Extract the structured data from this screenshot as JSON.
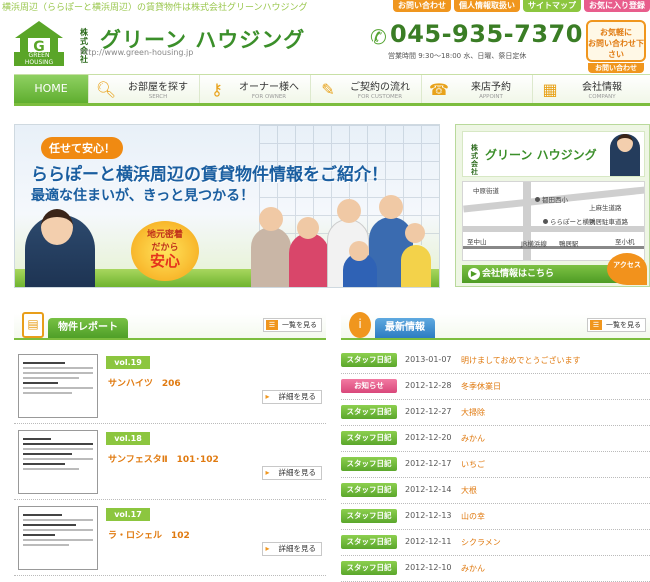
{
  "top": {
    "tagline": "横浜周辺（ららぽーと横浜周辺）の賃貸物件は株式会社グリーンハウジング",
    "links": [
      "お問い合わせ",
      "個人情報取扱い",
      "サイトマップ",
      "お気に入り登録"
    ]
  },
  "header": {
    "logo_text": "GREEN HOUSING",
    "kabu": "株式会社",
    "brand": "グリーン ハウジング",
    "url": "http://www.green-housing.jp",
    "phone": "045-935-7370",
    "hours": "営業時間 9:30〜18:00 水、日曜、祭日定休",
    "contact_line1": "お気軽に",
    "contact_line2": "お問い合わせ下さい",
    "contact_sub": "お問い合わせ"
  },
  "nav": {
    "home": "HOME",
    "items": [
      {
        "label": "お部屋を探す",
        "sub": "SERCH"
      },
      {
        "label": "オーナー様へ",
        "sub": "FOR OWNER"
      },
      {
        "label": "ご契約の流れ",
        "sub": "FOR CUSTOMER"
      },
      {
        "label": "来店予約",
        "sub": "APPOINT"
      },
      {
        "label": "会社情報",
        "sub": "COMPANY"
      }
    ]
  },
  "hero": {
    "badge": "任せて安心！",
    "title": "ららぽーと横浜周辺の賃貸物件情報をご紹介！",
    "subtitle": "最適な住まいが、きっと見つかる！",
    "local_line1": "地元密着",
    "local_line2": "だから",
    "local_big": "安心"
  },
  "side": {
    "kabu": "株式会社",
    "brand": "グリーン ハウジング",
    "map_labels": [
      "中原街道",
      "都田西小",
      "上麻生道路",
      "ららぽーと横浜",
      "鴨居駐車道路",
      "至中山",
      "JR横浜線",
      "鴨居駅",
      "至小机"
    ],
    "button": "会社情報はこちら",
    "access": "アクセス"
  },
  "reports": {
    "title": "物件レポート",
    "more": "一覧を見る",
    "detail": "詳細を見る",
    "items": [
      {
        "vol": "vol.19",
        "name": "サンハイツ　206"
      },
      {
        "vol": "vol.18",
        "name": "サンフェスタⅡ　101･102"
      },
      {
        "vol": "vol.17",
        "name": "ラ・ロシェル　102"
      }
    ]
  },
  "news": {
    "title": "最新情報",
    "more": "一覧を見る",
    "items": [
      {
        "cat": "スタッフ日記",
        "type": "staff",
        "date": "2013-01-07",
        "title": "明けましておめでとうございます"
      },
      {
        "cat": "お知らせ",
        "type": "notice",
        "date": "2012-12-28",
        "title": "冬季休業日"
      },
      {
        "cat": "スタッフ日記",
        "type": "staff",
        "date": "2012-12-27",
        "title": "大掃除"
      },
      {
        "cat": "スタッフ日記",
        "type": "staff",
        "date": "2012-12-20",
        "title": "みかん"
      },
      {
        "cat": "スタッフ日記",
        "type": "staff",
        "date": "2012-12-17",
        "title": "いちご"
      },
      {
        "cat": "スタッフ日記",
        "type": "staff",
        "date": "2012-12-14",
        "title": "大根"
      },
      {
        "cat": "スタッフ日記",
        "type": "staff",
        "date": "2012-12-13",
        "title": "山の幸"
      },
      {
        "cat": "スタッフ日記",
        "type": "staff",
        "date": "2012-12-11",
        "title": "シクラメン"
      },
      {
        "cat": "スタッフ日記",
        "type": "staff",
        "date": "2012-12-10",
        "title": "みかん"
      }
    ]
  },
  "colors": {
    "brand_green": "#5aa528",
    "accent_orange": "#f0961e",
    "notice_pink": "#e85d8c"
  }
}
